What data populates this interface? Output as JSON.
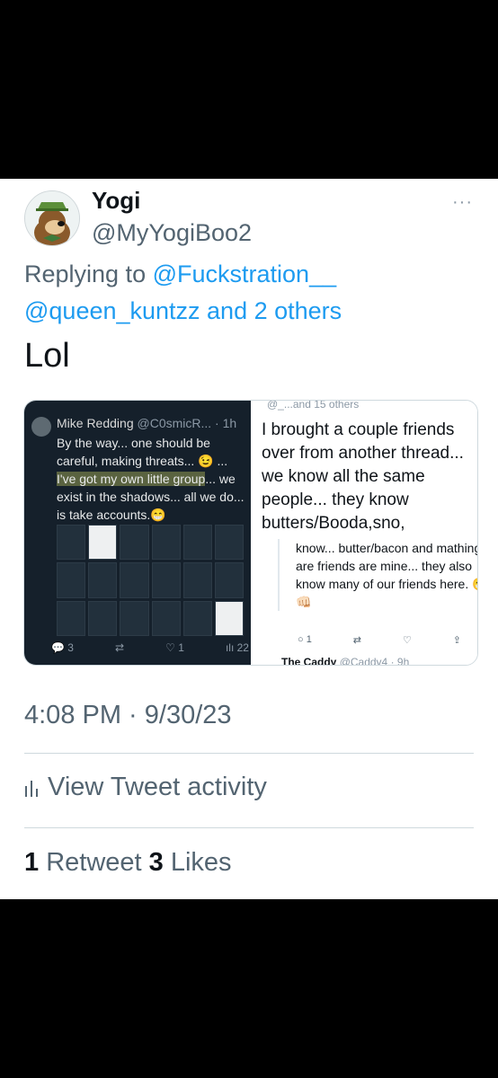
{
  "tweet": {
    "display_name": "Yogi",
    "handle": "@MyYogiBoo2",
    "more_icon": "···",
    "replying_prefix": "Replying to",
    "replying_to_1": "@Fuckstration__",
    "replying_to_2": "@queen_kuntzz and 2 others",
    "text": "Lol",
    "timestamp": "4:08 PM · 9/30/23",
    "activity_label": "View Tweet activity",
    "retweets_count": "1",
    "retweets_label": "Retweet",
    "likes_count": "3",
    "likes_label": "Likes"
  },
  "media": {
    "left": {
      "name": "Mike Redding",
      "handle_time": "@C0smicR... · 1h",
      "text_before": "By the way... one should be careful, making threats... 😉 ... ",
      "text_highlight": "I've got my own little group",
      "text_after": "... we exist in the shadows... all we do... is take accounts.😁",
      "actions": {
        "reply": "3",
        "retweet": "",
        "like": "1",
        "views": "22"
      }
    },
    "right": {
      "clipped_header": "@_...and 15 others",
      "text": "I brought a couple friends over from another thread... we know all the same people... they know butters/Booda,sno,",
      "quote": "know... butter/bacon and mathingy are friends are mine... they also know many of our friends here. 😁👊🏻",
      "quote_actions": {
        "reply": "1"
      },
      "next_name": "The Caddy",
      "next_handle": "@Caddy4 · 9h"
    }
  },
  "colors": {
    "link": "#1d9bf0",
    "muted": "#536471",
    "text": "#0f1419",
    "dark_bg": "#15202b"
  }
}
